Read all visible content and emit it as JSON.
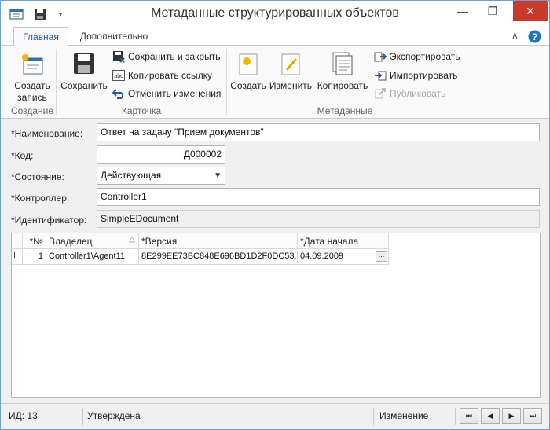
{
  "window": {
    "title": "Метаданные структурированных объектов",
    "minimize": "—",
    "restore": "❐",
    "close": "✕"
  },
  "ribbon_tabs": {
    "main": "Главная",
    "extra": "Дополнительно"
  },
  "ribbon": {
    "create_record": "Создать запись",
    "group_create": "Создание",
    "save": "Сохранить",
    "save_and_close": "Сохранить и закрыть",
    "copy_link": "Копировать ссылку",
    "undo_changes": "Отменить изменения",
    "group_card": "Карточка",
    "meta_create": "Создать",
    "meta_edit": "Изменить",
    "meta_copy": "Копировать",
    "export": "Экспортировать",
    "import": "Импортировать",
    "publish": "Публиковать",
    "group_metadata": "Метаданные"
  },
  "form": {
    "name_label": "*Наименование:",
    "name_value": "Ответ на задачу \"Прием документов\"",
    "code_label": "*Код:",
    "code_value": "Д000002",
    "state_label": "*Состояние:",
    "state_value": "Действующая",
    "controller_label": "*Контроллер:",
    "controller_value": "Controller1",
    "id_label": "*Идентификатор:",
    "id_value": "SimpleEDocument"
  },
  "grid": {
    "headers": {
      "num": "*№",
      "owner": "Владелец",
      "version": "*Версия",
      "start_date": "*Дата начала"
    },
    "rows": [
      {
        "num": "1",
        "owner": "Controller1\\Agent11",
        "version": "8E299EE73BC848E696BD1D2F0DC53...",
        "start_date": "04.09.2009",
        "ellipsis": "..."
      }
    ]
  },
  "status": {
    "id": "ИД: 13",
    "approval": "Утверждена",
    "mode": "Изменение"
  },
  "colors": {
    "accent": "#2b579a",
    "close": "#c7392b",
    "help": "#1e73be"
  }
}
